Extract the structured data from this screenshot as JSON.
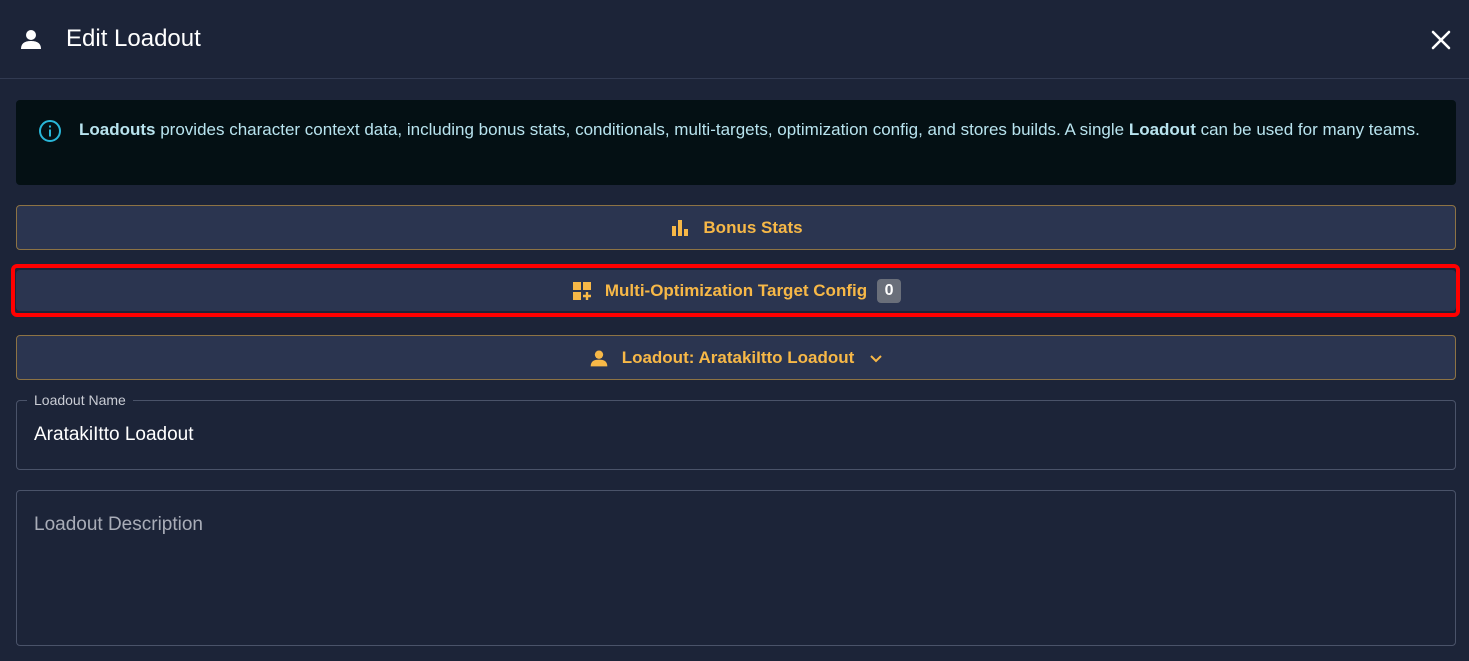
{
  "header": {
    "title": "Edit Loadout"
  },
  "alert": {
    "bold1": "Loadouts",
    "text1": " provides character context data, including bonus stats, conditionals, multi-targets, optimization config, and stores builds. A single ",
    "bold2": "Loadout",
    "text2": " can be used for many teams."
  },
  "buttons": {
    "bonus_stats": "Bonus Stats",
    "multi_target": "Multi-Optimization Target Config",
    "multi_target_count": "0",
    "loadout": "Loadout: AratakiItto Loadout"
  },
  "fields": {
    "name_label": "Loadout Name",
    "name_value": "AratakiItto Loadout",
    "description_placeholder": "Loadout Description"
  },
  "colors": {
    "accent": "#f7b847",
    "background": "#1c2438",
    "alert_bg": "#041014",
    "alert_text": "#b8e3ee",
    "highlight": "#ff0000"
  }
}
